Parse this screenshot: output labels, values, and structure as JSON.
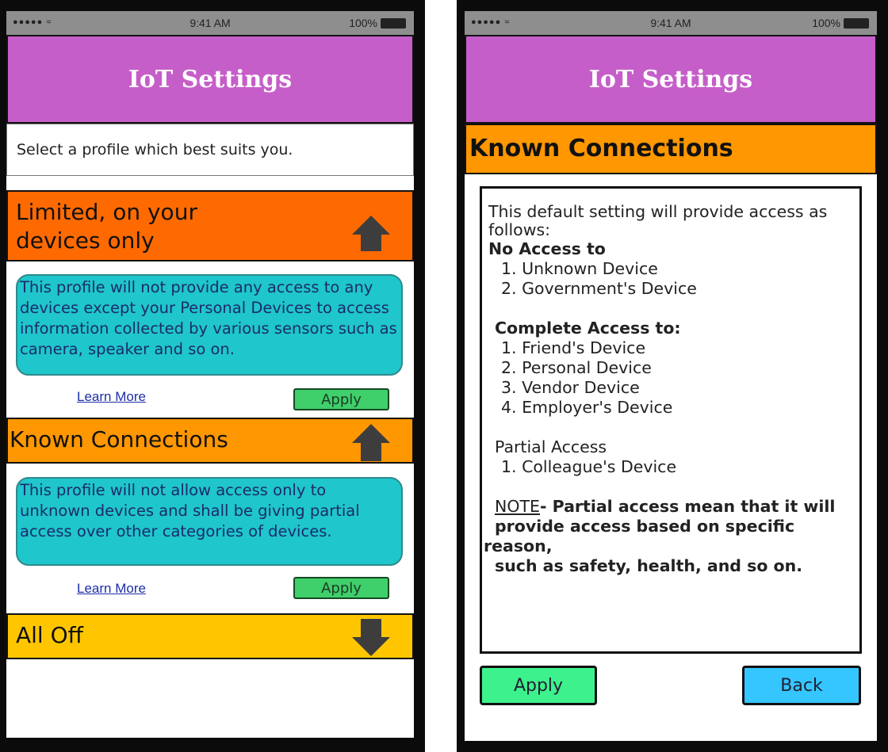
{
  "left_screen": {
    "status_bar": {
      "signal": "●●●●● ≈",
      "time": "9:41 AM",
      "battery": "100%"
    },
    "title": "IoT Settings",
    "subtitle": "Select a profile which best suits you.",
    "profiles": [
      {
        "label_line1": "Limited, on your",
        "label_line2": "devices only",
        "color": "#ff6a00",
        "arrow": "arrow-up",
        "description": "This profile will not provide any access to any devices except your Personal Devices to access information collected by various sensors such as camera, speaker and so on.",
        "learn_more": "Learn More",
        "apply": "Apply"
      },
      {
        "label": "Known Connections",
        "color": "#ff9700",
        "arrow": "arrow-up",
        "description": "This profile will not allow access only to unknown devices and shall be giving partial access over other categories of devices.",
        "learn_more": "Learn More",
        "apply": "Apply"
      },
      {
        "label": "All Off",
        "color": "#ffc600",
        "arrow": "arrow-down"
      }
    ]
  },
  "right_screen": {
    "status_bar": {
      "signal": "●●●●● ≈",
      "time": "9:41 AM",
      "battery": "100%"
    },
    "title": "IoT Settings",
    "section_title": "Known Connections",
    "details": {
      "intro": "This default setting will provide access as follows:",
      "no_access_heading": "No Access to",
      "no_access_items": [
        "1. Unknown Device",
        "2. Government's Device"
      ],
      "complete_access_heading": "Complete Access to:",
      "complete_access_items": [
        "1. Friend's Device",
        "2. Personal Device",
        "3. Vendor Device",
        "4. Employer's Device"
      ],
      "partial_access_heading": "Partial Access",
      "partial_access_items": [
        "1. Colleague's Device"
      ],
      "note_label": "NOTE",
      "note_line1": "- Partial access mean that it will",
      "note_line2": "provide access based on specific",
      "note_line3": "reason,",
      "note_line4": "such as safety, health, and so on."
    },
    "apply_button": "Apply",
    "back_button": "Back"
  },
  "colors": {
    "title_bar": "#c65ec9",
    "limited_band": "#ff6a00",
    "known_band": "#ff9700",
    "all_off_band": "#ffc600",
    "description_bubble": "#1fc6cb",
    "apply_green": "#3fcf6b",
    "apply_big": "#3df28c",
    "back_blue": "#35c6ff"
  }
}
